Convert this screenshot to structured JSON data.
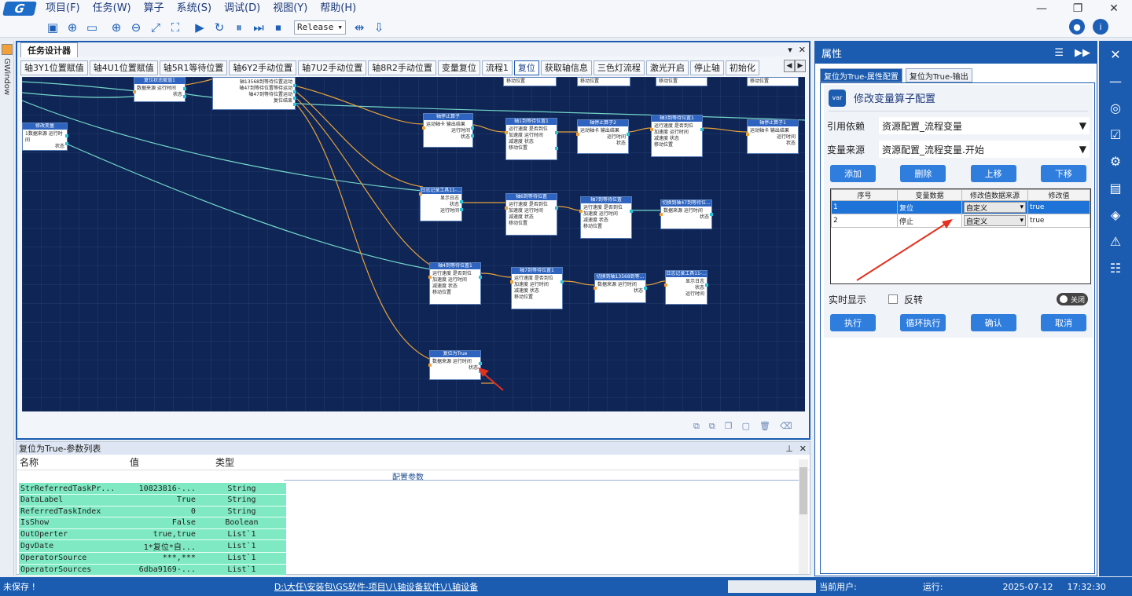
{
  "menu": [
    "项目(F)",
    "任务(W)",
    "算子",
    "系统(S)",
    "调试(D)",
    "视图(Y)",
    "帮助(H)"
  ],
  "logo_text": "G",
  "toolbar": {
    "config": "Release"
  },
  "left_strip": {
    "label": "GWindow"
  },
  "designer": {
    "tab_title": "任务设计器",
    "flow_tabs": [
      "轴3Y1位置赋值",
      "轴4U1位置赋值",
      "轴5R1等待位置",
      "轴6Y2手动位置",
      "轴7U2手动位置",
      "轴8R2手动位置",
      "变量复位",
      "流程1",
      "复位",
      "获取轴信息",
      "三色灯流程",
      "激光开启",
      "停止轴",
      "初始化"
    ],
    "active_flow_tab": "复位",
    "nodes": [
      {
        "title": "复位状态赋值1",
        "body": [
          "数据来源  运行时间",
          "状态"
        ]
      },
      {
        "title": "",
        "body": [
          "轴13568到等待位置运动",
          "轴47到等待位置等待运动",
          "轴47到等待位置运动",
          "复位结束"
        ]
      },
      {
        "title": "修改变量",
        "body": [
          "1数据来源  运行时间",
          "状态"
        ]
      },
      {
        "title": "轴停止算子",
        "body": [
          "运动轴卡  输出结果",
          "运行时间",
          "状态"
        ]
      },
      {
        "title": "轴1到等待位置1",
        "body": [
          "运行速度  是否到位",
          "加速度  运行时间",
          "减速度  状态",
          "移动位置"
        ]
      },
      {
        "title": "轴停止算子2",
        "body": [
          "运动轴卡  输出结果",
          "运行时间",
          "状态"
        ]
      },
      {
        "title": "轴3到等待位置1",
        "body": [
          "运行速度  是否到位",
          "加速度  运行时间",
          "减速度  状态",
          "移动位置"
        ]
      },
      {
        "title": "轴停止算子1",
        "body": [
          "运动轴卡  输出结果",
          "运行时间",
          "状态"
        ]
      },
      {
        "title": "日志记录工具11-...",
        "body": [
          "显示日志",
          "状态",
          "运行时间"
        ]
      },
      {
        "title": "轴6到等待位置",
        "body": [
          "运行速度  是否到位",
          "加速度  运行时间",
          "减速度  状态",
          "移动位置"
        ]
      },
      {
        "title": "轴7到等待位置",
        "body": [
          "运行速度  是否到位",
          "加速度  运行时间",
          "减速度  状态",
          "移动位置"
        ]
      },
      {
        "title": "切换到轴47到等待位...",
        "body": [
          "数据来源  运行时间",
          "状态"
        ]
      },
      {
        "title": "轴4到等待位置1",
        "body": [
          "运行速度  是否到位",
          "加速度  运行时间",
          "减速度  状态",
          "移动位置"
        ]
      },
      {
        "title": "轴7到等待位置1",
        "body": [
          "运行速度  是否到位",
          "加速度  运行时间",
          "减速度  状态",
          "移动位置"
        ]
      },
      {
        "title": "切换到轴13568到等...",
        "body": [
          "数据来源  运行时间",
          "状态"
        ]
      },
      {
        "title": "日志记录工具11-...",
        "body": [
          "显示日志",
          "状态",
          "运行时间"
        ]
      },
      {
        "title": "复位为True",
        "body": [
          "数据来源  运行时间",
          "状态"
        ]
      }
    ],
    "partial_nodes": [
      "移动位置",
      "移动位置",
      "移动位置",
      "移动位置"
    ]
  },
  "params": {
    "title": "复位为True-参数列表",
    "columns": [
      "名称",
      "值",
      "类型"
    ],
    "section": "配置参数",
    "rows": [
      {
        "name": "StrReferredTaskPr...",
        "value": "10823816-...",
        "type": "String"
      },
      {
        "name": "DataLabel",
        "value": "True",
        "type": "String"
      },
      {
        "name": "ReferredTaskIndex",
        "value": "0",
        "type": "String"
      },
      {
        "name": "IsShow",
        "value": "False",
        "type": "Boolean"
      },
      {
        "name": "OutOperter",
        "value": "true,true",
        "type": "List`1"
      },
      {
        "name": "DgvDate",
        "value": "1*复位*自...",
        "type": "List`1"
      },
      {
        "name": "OperatorSource",
        "value": "***,***",
        "type": "List`1"
      },
      {
        "name": "OperatorSources",
        "value": "6dba9169-...",
        "type": "List`1"
      }
    ]
  },
  "props": {
    "title": "属性",
    "tabs": [
      "复位为True-属性配置",
      "复位为True-输出"
    ],
    "icon": "var",
    "card_title": "修改变量算子配置",
    "ref_label": "引用依赖",
    "ref_value": "资源配置_流程变量",
    "src_label": "变量来源",
    "src_value": "资源配置_流程变量.开始",
    "buttons": [
      "添加",
      "删除",
      "上移",
      "下移"
    ],
    "table_headers": [
      "序号",
      "变量数据",
      "修改值数据来源",
      "修改值"
    ],
    "table_rows": [
      {
        "idx": "1",
        "data": "复位",
        "src": "自定义",
        "val": "true"
      },
      {
        "idx": "2",
        "data": "停止",
        "src": "自定义",
        "val": "true"
      }
    ],
    "live_label": "实时显示",
    "invert_label": "反转",
    "toggle_label": "关闭",
    "bottom_buttons": [
      "执行",
      "循环执行",
      "确认",
      "取消"
    ]
  },
  "statusbar": {
    "saved": "未保存 !",
    "path": "D:\\大任\\安装包\\GS软件-项目\\八轴设备软件\\八轴设备",
    "user_label": "当前用户:",
    "run_label": "运行:",
    "date": "2025-07-12",
    "time": "17:32:30"
  },
  "colors": {
    "accent": "#1b5cb0",
    "canvas": "#0e2555",
    "link_orange": "#e8a23a",
    "link_cyan": "#74d6c8",
    "param_row": "#7fe9c4"
  }
}
